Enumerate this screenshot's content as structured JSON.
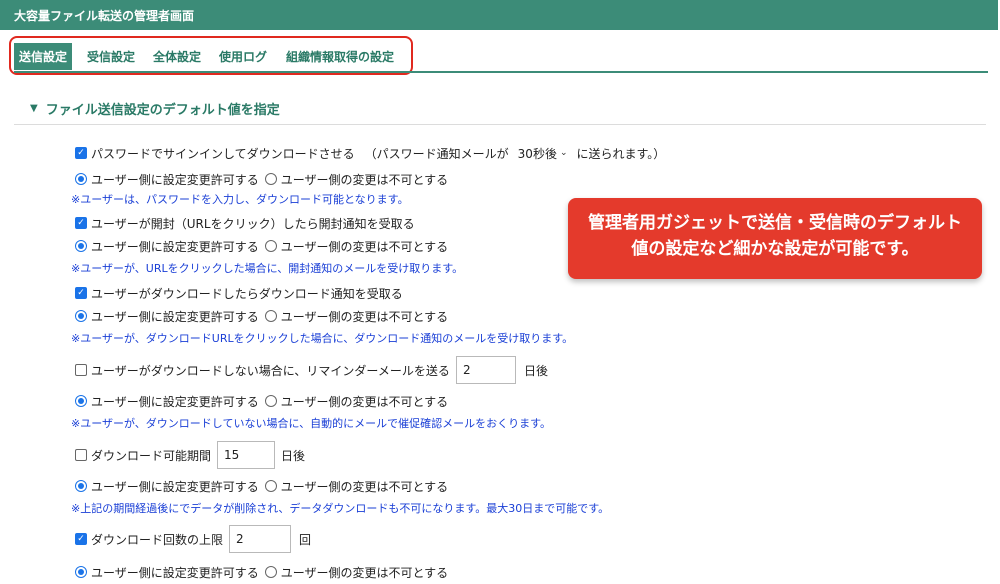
{
  "window": {
    "title": "大容量ファイル転送の管理者画面"
  },
  "tabs": [
    {
      "label": "送信設定",
      "active": true
    },
    {
      "label": "受信設定",
      "active": false
    },
    {
      "label": "全体設定",
      "active": false
    },
    {
      "label": "使用ログ",
      "active": false
    },
    {
      "label": "組織情報取得の設定",
      "active": false
    }
  ],
  "section": {
    "title": "ファイル送信設定のデフォルト値を指定"
  },
  "radio_labels": {
    "allow": "ユーザー側に設定変更許可する",
    "deny": "ユーザー側の変更は不可とする"
  },
  "settings": {
    "password_signin": {
      "label": "パスワードでサインインしてダウンロードさせる",
      "prefix": "（パスワード通知メールが",
      "select_value": "30秒後",
      "suffix": "に送られます。）",
      "checked": true,
      "note": "※ユーザーは、パスワードを入力し、ダウンロード可能となります。"
    },
    "open_notify": {
      "label": "ユーザーが開封（URLをクリック）したら開封通知を受取る",
      "checked": true,
      "note": "※ユーザーが、URLをクリックした場合に、開封通知のメールを受け取ります。"
    },
    "download_notify": {
      "label": "ユーザーがダウンロードしたらダウンロード通知を受取る",
      "checked": true,
      "note": "※ユーザーが、ダウンロードURLをクリックした場合に、ダウンロード通知のメールを受け取ります。"
    },
    "reminder": {
      "label": "ユーザーがダウンロードしない場合に、リマインダーメールを送る",
      "value": "2",
      "unit": "日後",
      "checked": false,
      "note": "※ユーザーが、ダウンロードしていない場合に、自動的にメールで催促確認メールをおくります。"
    },
    "period": {
      "label": "ダウンロード可能期間",
      "value": "15",
      "unit": "日後",
      "checked": false,
      "note": "※上記の期間経過後にでデータが削除され、データダウンロードも不可になります。最大30日まで可能です。"
    },
    "limit": {
      "label": "ダウンロード回数の上限",
      "value": "2",
      "unit": "回",
      "checked": true
    }
  },
  "callout": {
    "text": "管理者用ガジェットで送信・受信時のデフォルト値の設定など細かな設定が可能です。"
  },
  "colors": {
    "header": "#3c8c78",
    "accent_text": "#2a7a66",
    "note": "#1a3fd6",
    "callout": "#e43a2c",
    "frame": "#e0291f"
  }
}
